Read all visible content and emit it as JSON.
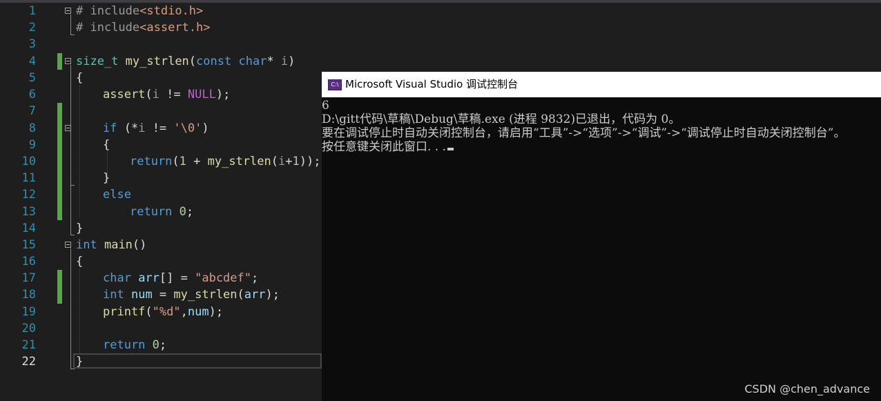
{
  "editor": {
    "line_numbers": [
      "1",
      "2",
      "3",
      "4",
      "5",
      "6",
      "7",
      "8",
      "9",
      "10",
      "11",
      "12",
      "13",
      "14",
      "15",
      "16",
      "17",
      "18",
      "19",
      "20",
      "21",
      "22"
    ],
    "code": {
      "l1": {
        "hash": "# ",
        "kw": "include",
        "hdr": "<stdio.h>"
      },
      "l2": {
        "hash": "# ",
        "kw": "include",
        "hdr": "<assert.h>"
      },
      "l4": {
        "type": "size_t",
        "fn": "my_strlen",
        "p1": "(",
        "kw_const": "const",
        "kw_char": "char",
        "p2": "* ",
        "param": "i",
        "p3": ")"
      },
      "l5": {
        "brace": "{"
      },
      "l6": {
        "fn": "assert",
        "p1": "(",
        "param": "i",
        "op": " != ",
        "macro": "NULL",
        "p2": ");"
      },
      "l8": {
        "kw": "if",
        "p1": " (*",
        "param": "i",
        "op": " != ",
        "str": "'\\0'",
        "p2": ")"
      },
      "l9": {
        "brace": "{"
      },
      "l10": {
        "kw": "return",
        "p1": "(",
        "num": "1",
        "op": " + ",
        "fn": "my_strlen",
        "p2": "(",
        "param": "i",
        "p3": "+",
        "num2": "1",
        "p4": "));"
      },
      "l11": {
        "brace": "}"
      },
      "l12": {
        "kw": "else"
      },
      "l13": {
        "kw": "return",
        "num": "0",
        "p": ";"
      },
      "l14": {
        "brace": "}"
      },
      "l15": {
        "kw": "int",
        "fn": "main",
        "p": "()"
      },
      "l16": {
        "brace": "{"
      },
      "l17": {
        "kw": "char",
        "var": "arr",
        "p1": "[] = ",
        "str": "\"abcdef\"",
        "p2": ";"
      },
      "l18": {
        "kw": "int",
        "var": "num",
        "p1": " = ",
        "fn": "my_strlen",
        "p2": "(",
        "var2": "arr",
        "p3": ");"
      },
      "l19": {
        "fn": "printf",
        "p1": "(",
        "str": "\"%d\"",
        "p2": ",",
        "var": "num",
        "p3": ");"
      },
      "l21": {
        "kw": "return",
        "num": "0",
        "p": ";"
      },
      "l22": {
        "brace": "}"
      }
    }
  },
  "console": {
    "title": "Microsoft Visual Studio 调试控制台",
    "icon_text": "C:\\",
    "lines": [
      "6",
      "D:\\gitt代码\\草稿\\Debug\\草稿.exe (进程 9832)已退出，代码为 0。",
      "要在调试停止时自动关闭控制台，请启用“工具”->“选项”->“调试”->“调试停止时自动关闭控制台”。",
      "按任意键关闭此窗口. . ."
    ]
  },
  "watermark": "CSDN @chen_advance",
  "colors": {
    "editor_bg": "#1e1e1e",
    "keyword": "#569cd6",
    "type": "#4ec9b0",
    "function": "#dcdcaa",
    "string": "#d69d85",
    "number": "#b5cea8",
    "macro": "#bd63c5",
    "change_marker": "#57a64a",
    "line_number": "#2b91af",
    "console_bg": "#0c0c0c"
  }
}
